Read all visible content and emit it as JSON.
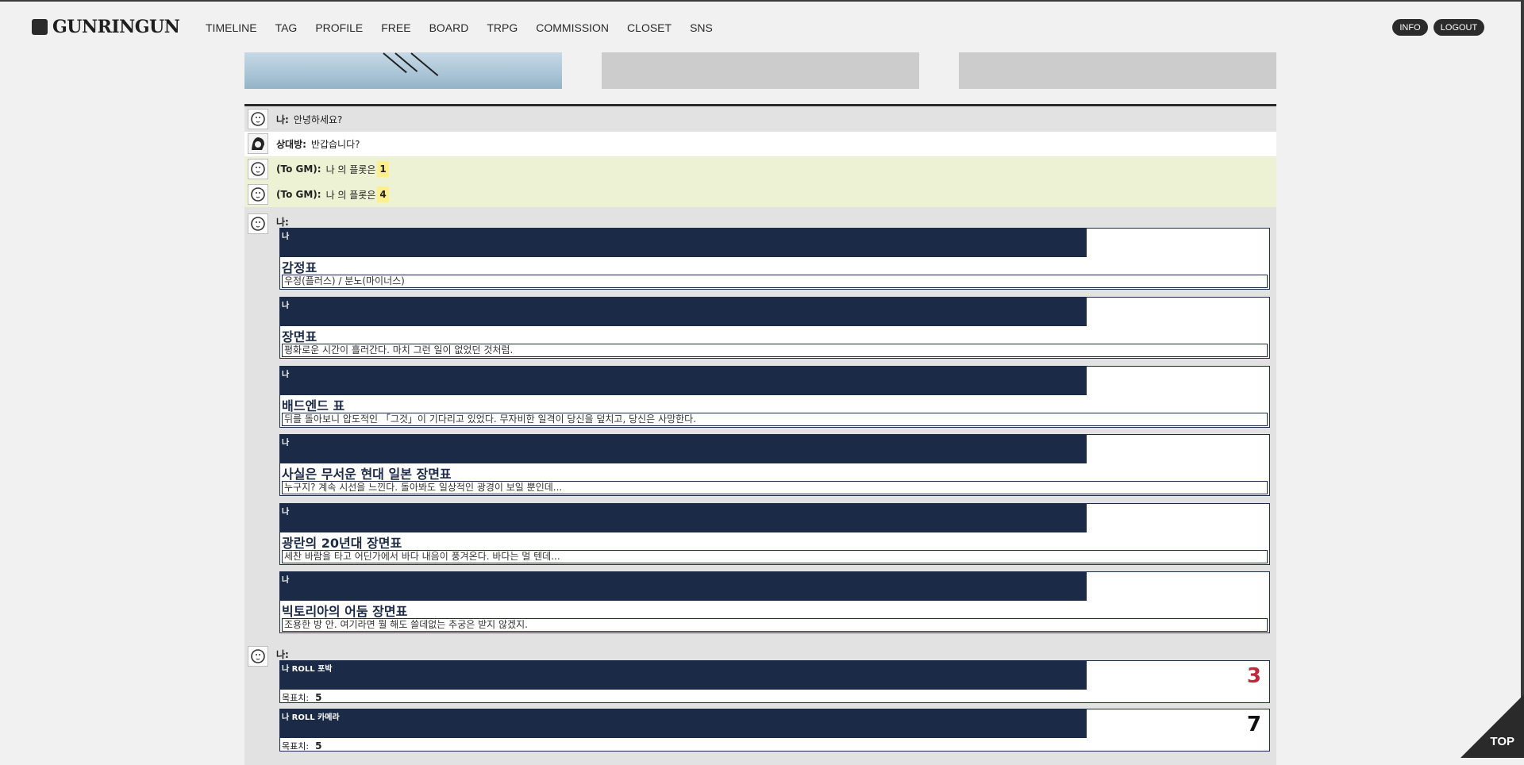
{
  "logo": {
    "text": "GUNRINGUN"
  },
  "nav": [
    "TIMELINE",
    "TAG",
    "PROFILE",
    "FREE",
    "BOARD",
    "TRPG",
    "COMMISSION",
    "CLOSET",
    "SNS"
  ],
  "header_buttons": {
    "info": "INFO",
    "logout": "LOGOUT"
  },
  "messages": [
    {
      "speaker": "나:",
      "text": "안녕하세요?"
    },
    {
      "speaker": "상대방:",
      "text": "반갑습니다?"
    },
    {
      "speaker": "(To GM):",
      "text": "나 의 플롯은",
      "value": "1"
    },
    {
      "speaker": "(To GM):",
      "text": "나 의 플롯은",
      "value": "4"
    }
  ],
  "table_block": {
    "speaker": "나:",
    "cards": [
      {
        "who": "나",
        "title": "감정표",
        "body": "우정(플러스) / 분노(마이너스)"
      },
      {
        "who": "나",
        "title": "장면표",
        "body": "평화로운 시간이 흘러간다. 마치 그런 일이 없었던 것처럼."
      },
      {
        "who": "나",
        "title": "배드엔드 표",
        "body": "뒤를 돌아보니 압도적인 「그것」이 기다리고 있었다. 무자비한 일격이 당신을 덮치고, 당신은 사망한다."
      },
      {
        "who": "나",
        "title": "사실은 무서운 현대 일본 장면표",
        "body": "누구지? 계속 시선을 느낀다. 돌아봐도 일상적인 광경이 보일 뿐인데..."
      },
      {
        "who": "나",
        "title": "광란의 20년대 장면표",
        "body": "세찬 바람을 타고 어딘가에서 바다 내음이 풍겨온다. 바다는 멀 텐데..."
      },
      {
        "who": "나",
        "title": "빅토리아의 어둠 장면표",
        "body": "조용한 방 안. 여기라면 뭘 해도 쓸데없는 추궁은 받지 않겠지."
      }
    ]
  },
  "roll_block": {
    "speaker": "나:",
    "rolls": [
      {
        "title": "나 ROLL 포박",
        "result": "3",
        "result_color": "#c0283c",
        "target_label": "목표치:",
        "target": "5"
      },
      {
        "title": "나 ROLL 카메라",
        "result": "7",
        "result_color": "#111111",
        "target_label": "목표치:",
        "target": "5"
      }
    ]
  },
  "top_button": "TOP",
  "colors": {
    "navy": "#1b2a47",
    "highlight": "#ffef8a",
    "gm_row": "#edf2d4"
  }
}
